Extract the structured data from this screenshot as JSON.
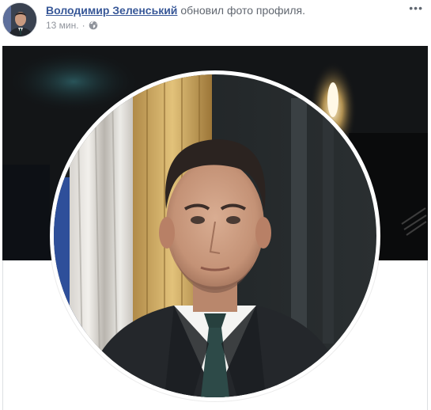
{
  "post": {
    "author_name": "Володимир Зеленський",
    "action_text": "обновил фото профиля.",
    "timestamp": "13 мин.",
    "separator": "·",
    "audience_icon": "globe-icon",
    "more_icon": "more-options-icon",
    "more_glyph": "•••"
  },
  "colors": {
    "link": "#385898",
    "secondary_text": "#616770",
    "meta_text": "#90949c",
    "cover_bg": "#1a1d1f"
  }
}
